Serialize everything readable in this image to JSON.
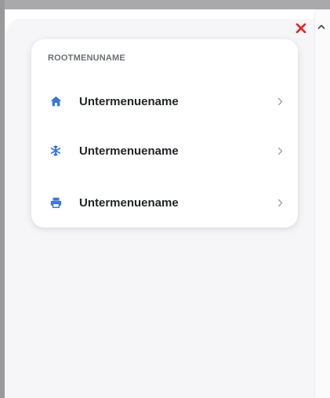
{
  "colors": {
    "accent": "#3b78d6",
    "close": "#e02424",
    "label": "#222428",
    "section_title": "#6d6f78",
    "chevron": "#9a9ca4"
  },
  "header": {
    "close_icon": "close-icon",
    "collapse_icon": "chevron-up-icon"
  },
  "menu": {
    "root_title": "ROOTMENUNAME",
    "items": [
      {
        "label": "Untermenuename",
        "icon": "home-icon"
      },
      {
        "label": "Untermenuename",
        "icon": "snowflake-icon"
      },
      {
        "label": "Untermenuename",
        "icon": "printer-icon"
      }
    ]
  }
}
